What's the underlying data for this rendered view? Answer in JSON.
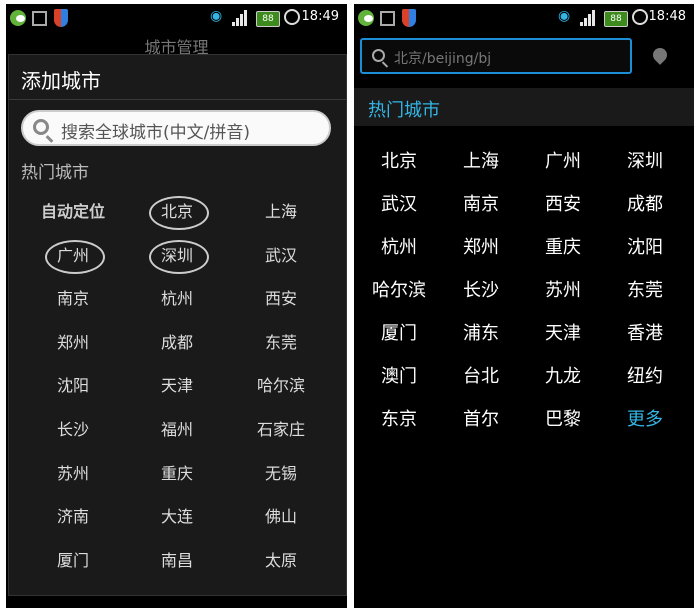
{
  "left_screen": {
    "status_bar": {
      "time": "18:49",
      "battery": "88"
    },
    "background_title": "城市管理",
    "dialog_title": "添加城市",
    "search": {
      "placeholder": "搜索全球城市(中文/拼音)"
    },
    "hot_label": "热门城市",
    "cities": [
      "自动定位",
      "北京",
      "上海",
      "广州",
      "深圳",
      "武汉",
      "南京",
      "杭州",
      "西安",
      "郑州",
      "成都",
      "东莞",
      "沈阳",
      "天津",
      "哈尔滨",
      "长沙",
      "福州",
      "石家庄",
      "苏州",
      "重庆",
      "无锡",
      "济南",
      "大连",
      "佛山",
      "厦门",
      "南昌",
      "太原"
    ]
  },
  "right_screen": {
    "status_bar": {
      "time": "18:48",
      "battery": "88"
    },
    "search": {
      "value": "北京/beijing/bj"
    },
    "hot_label": "热门城市",
    "cities": [
      "北京",
      "上海",
      "广州",
      "深圳",
      "武汉",
      "南京",
      "西安",
      "成都",
      "杭州",
      "郑州",
      "重庆",
      "沈阳",
      "哈尔滨",
      "长沙",
      "苏州",
      "东莞",
      "厦门",
      "浦东",
      "天津",
      "香港",
      "澳门",
      "台北",
      "九龙",
      "纽约",
      "东京",
      "首尔",
      "巴黎",
      "更多"
    ]
  },
  "colors": {
    "accent": "#33b5e5",
    "search_border": "#1c8ed8"
  },
  "icons": [
    "wechat-icon",
    "mail-icon",
    "shield-icon",
    "wifi-icon",
    "signal-icon",
    "battery-icon",
    "alarm-icon",
    "search-icon",
    "location-pin-icon"
  ]
}
